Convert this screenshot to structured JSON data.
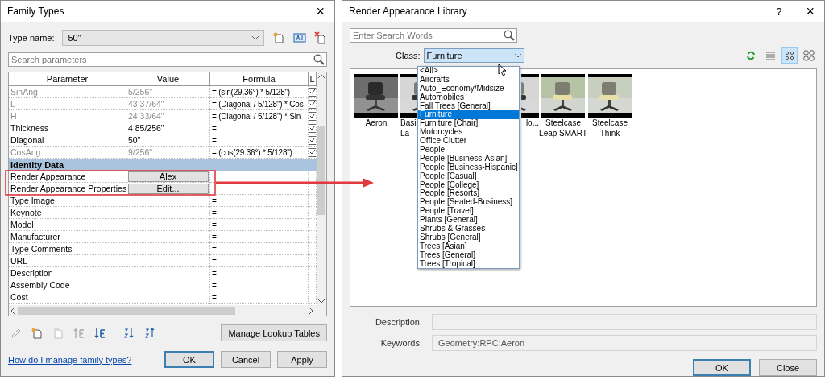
{
  "family_types": {
    "title": "Family Types",
    "close": "×",
    "type_name": {
      "label": "Type name:",
      "value": "50\""
    },
    "search": {
      "placeholder": "Search parameters"
    },
    "table": {
      "columns": [
        "Parameter",
        "Value",
        "Formula",
        "L"
      ],
      "rows": [
        {
          "kind": "param",
          "name": "SinAng",
          "value": "5/256\"",
          "formula": "= (sin(29.36°) * 5/128\")",
          "disabled": true,
          "locked": true
        },
        {
          "kind": "param",
          "name": "L",
          "value": "43 37/64\"",
          "formula": "= (Diagonal / 5/128\") * Cos",
          "disabled": true,
          "locked": true
        },
        {
          "kind": "param",
          "name": "H",
          "value": "24 33/64\"",
          "formula": "= (Diagonal / 5/128\") * Sin",
          "disabled": true,
          "locked": true
        },
        {
          "kind": "param",
          "name": "Thickness",
          "value": "4 85/256\"",
          "formula": "=",
          "disabled": false,
          "locked": true
        },
        {
          "kind": "param",
          "name": "Diagonal",
          "value": "50\"",
          "formula": "=",
          "disabled": false,
          "locked": true
        },
        {
          "kind": "param",
          "name": "CosAng",
          "value": "9/256\"",
          "formula": "= (cos(29.36°) * 5/128\")",
          "disabled": true,
          "locked": true
        },
        {
          "kind": "group",
          "name": "Identity Data"
        },
        {
          "kind": "button",
          "name": "Render Appearance",
          "value": "Alex"
        },
        {
          "kind": "button",
          "name": "Render Appearance Properties",
          "value": "Edit..."
        },
        {
          "kind": "param",
          "name": "Type Image",
          "formula": "="
        },
        {
          "kind": "param",
          "name": "Keynote",
          "formula": "="
        },
        {
          "kind": "param",
          "name": "Model",
          "formula": "="
        },
        {
          "kind": "param",
          "name": "Manufacturer",
          "formula": "="
        },
        {
          "kind": "param",
          "name": "Type Comments",
          "formula": "="
        },
        {
          "kind": "param",
          "name": "URL",
          "formula": "="
        },
        {
          "kind": "param",
          "name": "Description",
          "formula": "="
        },
        {
          "kind": "param",
          "name": "Assembly Code",
          "formula": "="
        },
        {
          "kind": "param",
          "name": "Cost",
          "formula": "="
        }
      ]
    },
    "tools": [
      {
        "kind": "edit",
        "disabled": true
      },
      {
        "kind": "new",
        "disabled": false
      },
      {
        "kind": "duplicate",
        "disabled": true
      },
      {
        "kind": "move_up",
        "disabled": true
      },
      {
        "kind": "move_down",
        "disabled": false
      },
      {
        "kind": "sort_asc",
        "disabled": false
      },
      {
        "kind": "sort_desc",
        "disabled": false
      }
    ],
    "lookup_button": "Manage Lookup Tables",
    "help_link": "How do I manage family types?",
    "buttons": [
      {
        "label": "OK",
        "default": true
      },
      {
        "label": "Cancel",
        "default": false
      },
      {
        "label": "Apply",
        "default": false
      }
    ]
  },
  "library": {
    "title": "Render Appearance Library",
    "help": "?",
    "close": "×",
    "search": {
      "placeholder": "Enter Search Words"
    },
    "class": {
      "label": "Class:",
      "value": "Furniture",
      "expanded": true,
      "options": [
        {
          "label": "<All>",
          "selected": false
        },
        {
          "label": "Aircrafts",
          "selected": false
        },
        {
          "label": "Auto_Economy/Midsize",
          "selected": false
        },
        {
          "label": "Automobiles",
          "selected": false
        },
        {
          "label": "Fall Trees [General]",
          "selected": false
        },
        {
          "label": "Furniture",
          "selected": true
        },
        {
          "label": "Furniture [Chair]",
          "selected": false
        },
        {
          "label": "Motorcycles",
          "selected": false
        },
        {
          "label": "Office Clutter",
          "selected": false
        },
        {
          "label": "People",
          "selected": false
        },
        {
          "label": "People [Business-Asian]",
          "selected": false
        },
        {
          "label": "People [Business-Hispanic]",
          "selected": false
        },
        {
          "label": "People [Casual]",
          "selected": false
        },
        {
          "label": "People [College]",
          "selected": false
        },
        {
          "label": "People [Resorts]",
          "selected": false
        },
        {
          "label": "People [Seated-Business]",
          "selected": false
        },
        {
          "label": "People [Travel]",
          "selected": false
        },
        {
          "label": "Plants [General]",
          "selected": false
        },
        {
          "label": "Shrubs & Grasses",
          "selected": false
        },
        {
          "label": "Shrubs [General]",
          "selected": false
        },
        {
          "label": "Trees [Asian]",
          "selected": false
        },
        {
          "label": "Trees [General]",
          "selected": false
        },
        {
          "label": "Trees [Tropical]",
          "selected": false
        }
      ]
    },
    "views": [
      {
        "kind": "refresh",
        "selected": false
      },
      {
        "kind": "list",
        "selected": false
      },
      {
        "kind": "small_icons",
        "selected": true
      },
      {
        "kind": "large_icons",
        "selected": false
      }
    ],
    "thumbnails": [
      {
        "kind": "whole",
        "caption": [
          "Aeron"
        ]
      },
      {
        "kind": "leftpart",
        "caption": [
          "Basi",
          "La"
        ]
      },
      {
        "kind": "rightpart",
        "caption": [
          "lo..."
        ]
      },
      {
        "kind": "whole",
        "caption": [
          "Steelcase",
          "Leap SMART"
        ]
      },
      {
        "kind": "whole",
        "caption": [
          "Steelcase",
          "Think"
        ]
      }
    ],
    "description": {
      "label": "Description:"
    },
    "keywords": {
      "label": "Keywords:",
      "value": ":Geometry:RPC:Aeron"
    },
    "buttons": [
      {
        "label": "OK",
        "default": true
      },
      {
        "label": "Close",
        "default": false
      }
    ]
  }
}
